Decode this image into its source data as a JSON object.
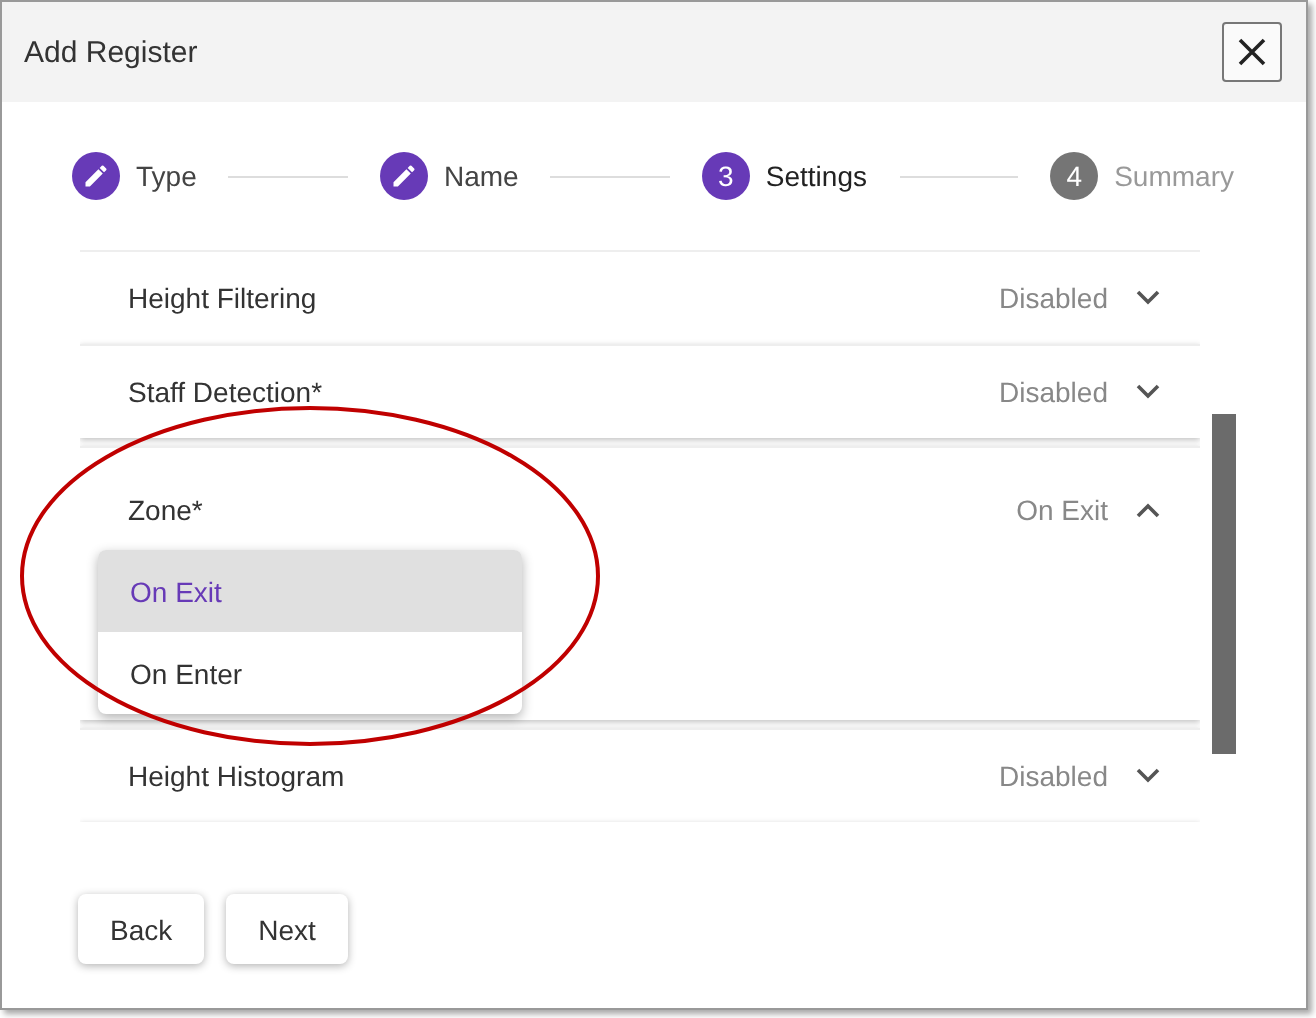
{
  "window": {
    "title": "Add Register"
  },
  "steps": [
    {
      "label": "Type",
      "kind": "done"
    },
    {
      "label": "Name",
      "kind": "done"
    },
    {
      "label": "Settings",
      "kind": "active",
      "number": "3"
    },
    {
      "label": "Summary",
      "kind": "pending",
      "number": "4"
    }
  ],
  "panels": [
    {
      "title": "Height Filtering",
      "value": "Disabled",
      "expanded": false
    },
    {
      "title": "Staff Detection*",
      "value": "Disabled",
      "expanded": false
    },
    {
      "title": "Zone*",
      "value": "On Exit",
      "expanded": true
    },
    {
      "title": "Height Histogram",
      "value": "Disabled",
      "expanded": false
    }
  ],
  "dropdown": {
    "options": [
      {
        "label": "On Exit",
        "selected": true
      },
      {
        "label": "On Enter",
        "selected": false
      }
    ]
  },
  "buttons": [
    "Back",
    "Next"
  ]
}
